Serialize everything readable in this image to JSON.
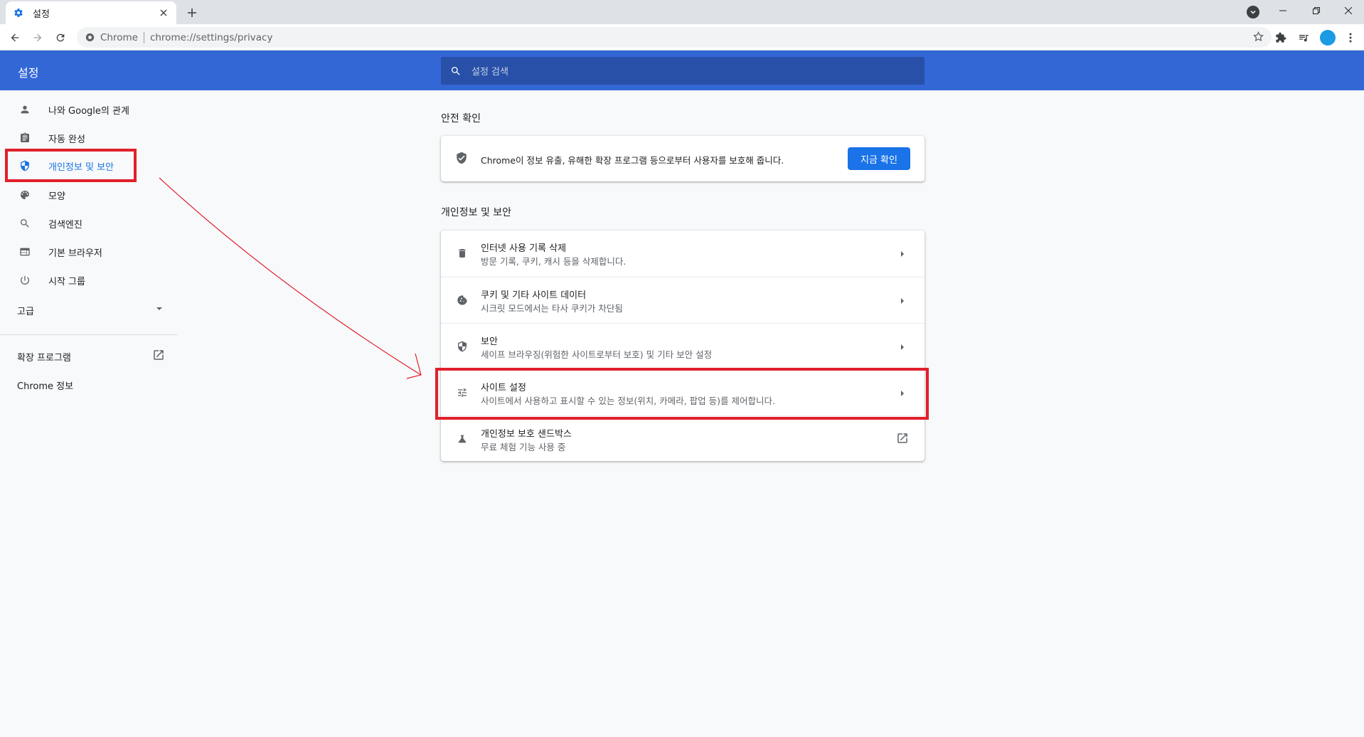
{
  "browser": {
    "tab_title": "설정",
    "site_chip": "Chrome",
    "url": "chrome://settings/privacy"
  },
  "header": {
    "title": "설정",
    "search_placeholder": "설정 검색"
  },
  "sidebar": {
    "items": [
      {
        "label": "나와 Google의 관계",
        "icon": "person-icon"
      },
      {
        "label": "자동 완성",
        "icon": "clipboard-icon"
      },
      {
        "label": "개인정보 및 보안",
        "icon": "shield-icon"
      },
      {
        "label": "모양",
        "icon": "palette-icon"
      },
      {
        "label": "검색엔진",
        "icon": "search-icon"
      },
      {
        "label": "기본 브라우저",
        "icon": "browser-icon"
      },
      {
        "label": "시작 그룹",
        "icon": "power-icon"
      }
    ],
    "advanced_label": "고급",
    "extensions_label": "확장 프로그램",
    "about_label": "Chrome 정보"
  },
  "safety_check": {
    "section_title": "안전 확인",
    "description": "Chrome이 정보 유출, 유해한 확장 프로그램 등으로부터 사용자를 보호해 줍니다.",
    "button_label": "지금 확인"
  },
  "privacy": {
    "section_title": "개인정보 및 보안",
    "rows": [
      {
        "title": "인터넷 사용 기록 삭제",
        "subtitle": "방문 기록, 쿠키, 캐시 등을 삭제합니다.",
        "icon": "trash-icon"
      },
      {
        "title": "쿠키 및 기타 사이트 데이터",
        "subtitle": "시크릿 모드에서는 타사 쿠키가 차단됨",
        "icon": "cookie-icon"
      },
      {
        "title": "보안",
        "subtitle": "세이프 브라우징(위험한 사이트로부터 보호) 및 기타 보안 설정",
        "icon": "shield-icon"
      },
      {
        "title": "사이트 설정",
        "subtitle": "사이트에서 사용하고 표시할 수 있는 정보(위치, 카메라, 팝업 등)를 제어합니다.",
        "icon": "sliders-icon"
      },
      {
        "title": "개인정보 보호 샌드박스",
        "subtitle": "무료 체험 기능 사용 중",
        "icon": "flask-icon"
      }
    ]
  },
  "colors": {
    "header_blue": "#3367d6",
    "accent": "#1a73e8",
    "annotation_red": "#e0202c"
  }
}
